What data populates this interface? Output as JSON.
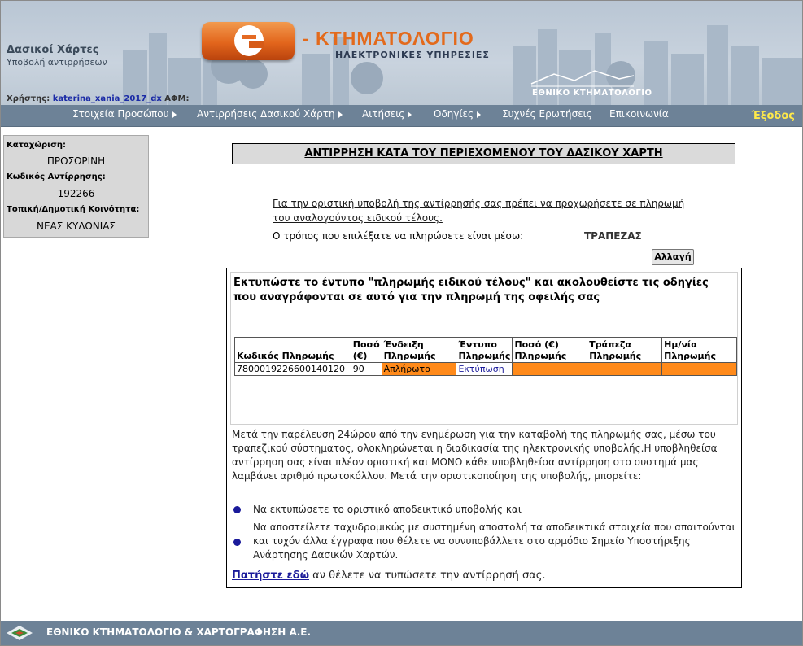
{
  "header": {
    "app_title": "Δασικοί Χάρτες",
    "app_subtitle": "Υποβολή αντιρρήσεων",
    "brand_main": "- ΚΤΗΜΑΤΟΛΟΓΙΟ",
    "brand_sub": "ΗΛΕΚΤΡΟΝΙΚΕΣ ΥΠΗΡΕΣΙΕΣ",
    "org_name": "ΕΘΝΙΚΟ ΚΤΗΜΑΤΟΛΟΓΙΟ",
    "user_label": "Χρήστης:",
    "user_name": "katerina_xania_2017_dx",
    "afm_label": "ΑΦΜ:"
  },
  "menu": {
    "items": [
      {
        "label": "Στοιχεία Προσώπου"
      },
      {
        "label": "Αντιρρήσεις Δασικού Χάρτη"
      },
      {
        "label": "Αιτήσεις"
      },
      {
        "label": "Οδηγίες"
      },
      {
        "label": "Συχνές Ερωτήσεις"
      },
      {
        "label": "Επικοινωνία"
      }
    ],
    "exit_label": "Έξοδος"
  },
  "sidebar": {
    "registration_label": "Καταχώριση:",
    "registration_value": "ΠΡΟΣΩΡΙΝΗ",
    "objection_code_label": "Κωδικός Αντίρρησης:",
    "objection_code_value": "192266",
    "community_label": "Τοπική/Δημοτική Κοινότητα:",
    "community_value": "ΝΕΑΣ ΚΥΔΩΝΙΑΣ"
  },
  "main": {
    "page_title": "ΑΝΤΙΡΡΗΣΗ ΚΑΤΑ ΤΟΥ ΠΕΡΙΕΧΟΜΕΝΟΥ ΤΟΥ ΔΑΣΙΚΟΥ ΧΑΡΤΗ",
    "notice": "Για την οριστική υποβολή της αντίρρησής σας πρέπει να προχωρήσετε σε πληρωμή του αναλογούντος ειδικού τέλους.",
    "method_label": "Ο τρόπος που επιλέξατε να πληρώσετε είναι μέσω:",
    "method_value": "ΤΡΑΠΕΖΑΣ",
    "change_button": "Αλλαγή",
    "instructions": "Εκτυπώστε το έντυπο \"πληρωμής ειδικού τέλους\" και ακολουθείστε τις οδηγίες που αναγράφονται σε αυτό για την πληρωμή της οφειλής σας",
    "table": {
      "headers": [
        "Κωδικός Πληρωμής",
        "Ποσό (€)",
        "Ένδειξη Πληρωμής",
        "Έντυπο Πληρωμής",
        "Ποσό (€) Πληρωμής",
        "Τράπεζα Πληρωμής",
        "Ημ/νία Πληρωμής"
      ],
      "row": {
        "code": "7800019226600140120",
        "amount": "90",
        "status": "Απλήρωτο",
        "print_link": "Εκτύπωση",
        "paid_amount": "",
        "bank": "",
        "date": ""
      }
    },
    "body_text": "Μετά την παρέλευση 24ώρου από την ενημέρωση για την καταβολή της πληρωμής σας, μέσω του τραπεζικού σύστηματος, ολοκληρώνεται η διαδικασία της ηλεκτρονικής υποβολής.Η υποβληθείσα αντίρρηση σας είναι πλέον οριστική και ΜΟΝΟ κάθε υποβληθείσα αντίρρηση στο συστημά μας λαμβάνει αριθμό πρωτοκόλλου. Μετά την οριστικοποίηση της υποβολής, μπορείτε:",
    "bullets": [
      "Να εκτυπώσετε το οριστικό αποδεικτικό υποβολής και",
      "Να αποστείλετε ταχυδρομικώς με συστημένη αποστολή τα αποδεικτικά στοιχεία που απαιτούνται και τυχόν άλλα έγγραφα που θέλετε να συνυποβάλλετε στο αρμόδιο Σημείο Υποστήριξης Ανάρτησης Δασικών Χαρτών."
    ],
    "click_link": "Πατήστε εδώ",
    "click_rest": " αν θέλετε να τυπώσετε την αντίρρησή σας."
  },
  "footer": {
    "org_full": "ΕΘΝΙΚΟ ΚΤΗΜΑΤΟΛΟΓΙΟ & ΧΑΡΤΟΓΡΑΦΗΣΗ Α.Ε."
  }
}
